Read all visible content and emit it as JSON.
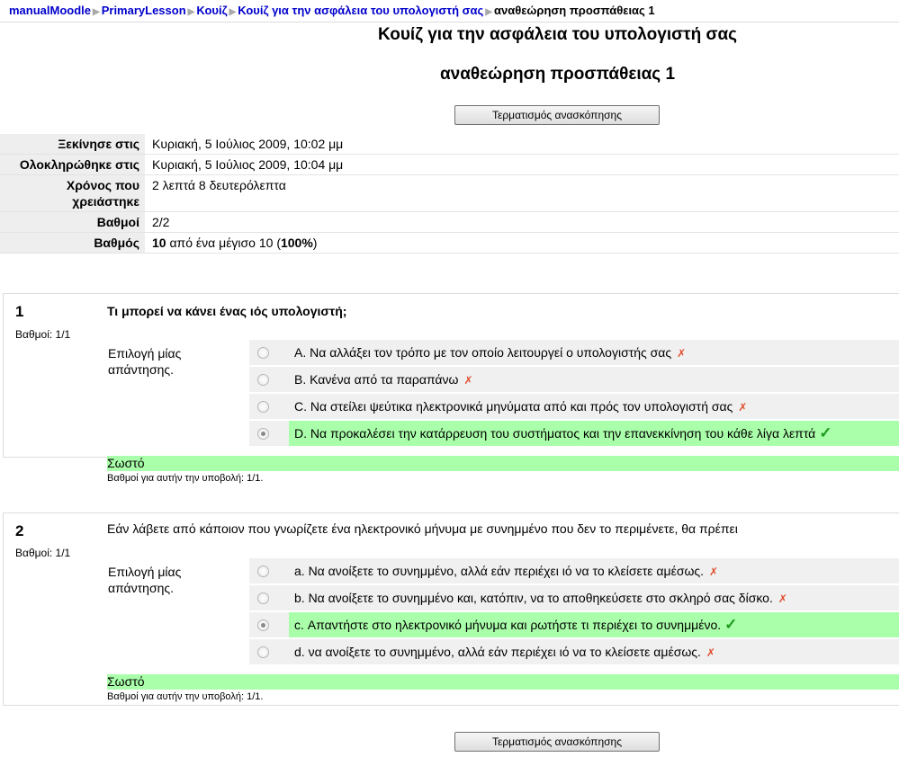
{
  "breadcrumb": [
    "manualMoodle",
    "PrimaryLesson",
    "Κουίζ",
    "Κουίζ για την ασφάλεια του υπολογιστή σας",
    "αναθεώρηση προσπάθειας 1"
  ],
  "breadcrumb_separator": "▶",
  "page": {
    "title": "Κουίζ για την ασφάλεια του υπολογιστή σας",
    "subtitle": "αναθεώρηση προσπάθειας 1",
    "finish_review_button": "Τερματισμός ανασκόπησης"
  },
  "summary": {
    "started_label": "Ξεκίνησε στις",
    "started_value": "Κυριακή, 5 Ιούλιος 2009, 10:02 μμ",
    "completed_label": "Ολοκληρώθηκε στις",
    "completed_value": "Κυριακή, 5 Ιούλιος 2009, 10:04 μμ",
    "time_label": "Χρόνος που χρειάστηκε",
    "time_value": "2 λεπτά 8 δευτερόλεπτα",
    "marks_label": "Βαθμοί",
    "marks_value": "2/2",
    "grade_label": "Βαθμός",
    "grade_score": "10",
    "grade_mid": " από ένα μέγισο 10 (",
    "grade_percent": "100%",
    "grade_end": ")"
  },
  "questions": [
    {
      "number": "1",
      "marks": "Βαθμοί: 1/1",
      "text": "Τι μπορεί να κάνει ένας ιός υπολογιστή;",
      "prompt": "Επιλογή μίας απάντησης.",
      "answers": [
        {
          "label": "A. Να αλλάξει τον τρόπο με τον οποίο λειτουργεί ο υπολογιστής σας",
          "mark": "✗"
        },
        {
          "label": "B. Κανένα από τα παραπάνω",
          "mark": "✗"
        },
        {
          "label": "C. Να στείλει ψεύτικα ηλεκτρονικά μηνύματα από και πρός τον υπολογιστή σας",
          "mark": "✗"
        },
        {
          "label": "D. Να προκαλέσει την κατάρρευση του συστήματος και την επανεκκίνηση του κάθε λίγα λεπτά",
          "mark": "✓"
        }
      ],
      "feedback": "Σωστό",
      "grading": "Βαθμοί για αυτήν την υποβολή: 1/1."
    },
    {
      "number": "2",
      "marks": "Βαθμοί: 1/1",
      "text": "Εάν λάβετε από κάποιον που γνωρίζετε ένα ηλεκτρονικό μήνυμα με συνημμένο που δεν το περιμένετε, θα πρέπει",
      "prompt": "Επιλογή μίας απάντησης.",
      "answers": [
        {
          "label": "a. Να ανοίξετε το συνημμένο, αλλά εάν περιέχει ιό να το κλείσετε αμέσως.",
          "mark": "✗"
        },
        {
          "label": "b. Να ανοίξετε το συνημμένο και, κατόπιν, να το αποθηκεύσετε στο σκληρό σας δίσκο.",
          "mark": "✗"
        },
        {
          "label": "c. Απαντήστε στο ηλεκτρονικό μήνυμα και ρωτήστε τι περιέχει το συνημμένο.",
          "mark": "✓"
        },
        {
          "label": "d. να ανοίξετε το συνημμένο, αλλά εάν περιέχει ιό να το κλείσετε αμέσως.",
          "mark": "✗"
        }
      ],
      "feedback": "Σωστό",
      "grading": "Βαθμοί για αυτήν την υποβολή: 1/1."
    }
  ]
}
